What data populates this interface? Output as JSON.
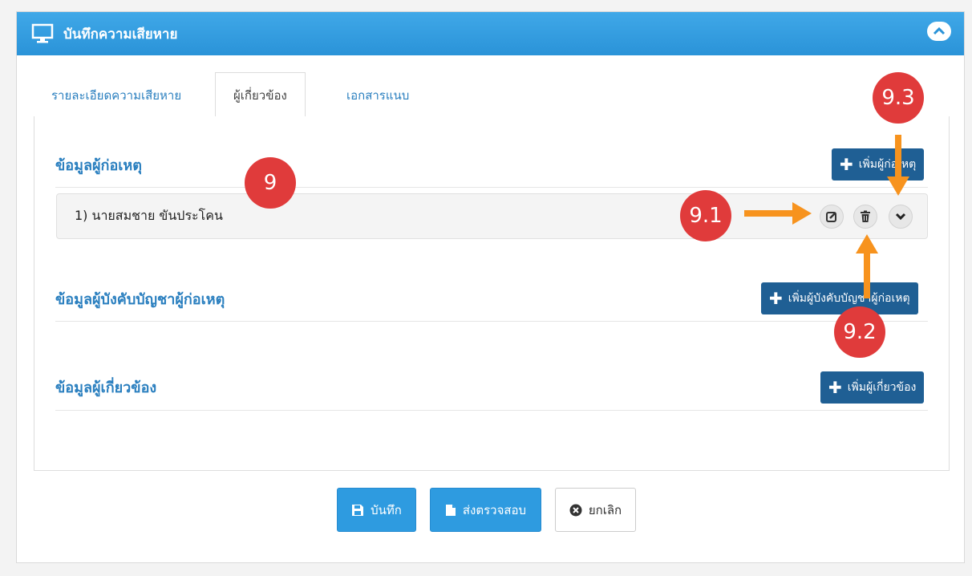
{
  "header": {
    "title": "บันทึกความเสียหาย"
  },
  "tabs": [
    {
      "label": "รายละเอียดความเสียหาย"
    },
    {
      "label": "ผู้เกี่ยวข้อง"
    },
    {
      "label": "เอกสารแนบ"
    }
  ],
  "sections": {
    "offender": {
      "title": "ข้อมูลผู้ก่อเหตุ",
      "add_label": "เพิ่มผู้ก่อเหตุ"
    },
    "supervisor": {
      "title": "ข้อมูลผู้บังคับบัญชาผู้ก่อเหตุ",
      "add_label": "เพิ่มผู้บังคับบัญชาผู้ก่อเหตุ"
    },
    "related": {
      "title": "ข้อมูลผู้เกี่ยวข้อง",
      "add_label": "เพิ่มผู้เกี่ยวข้อง"
    }
  },
  "offender_row": {
    "text": "1) นายสมชาย ขันประโคน"
  },
  "footer": {
    "save": "บันทึก",
    "submit": "ส่งตรวจสอบ",
    "cancel": "ยกเลิก"
  },
  "annotations": {
    "a9": "9",
    "a91": "9.1",
    "a92": "9.2",
    "a93": "9.3"
  },
  "colors": {
    "header": "#2a93d8",
    "primary_button": "#1f5f94",
    "badge": "#e03b3b",
    "arrow": "#f7931e"
  }
}
